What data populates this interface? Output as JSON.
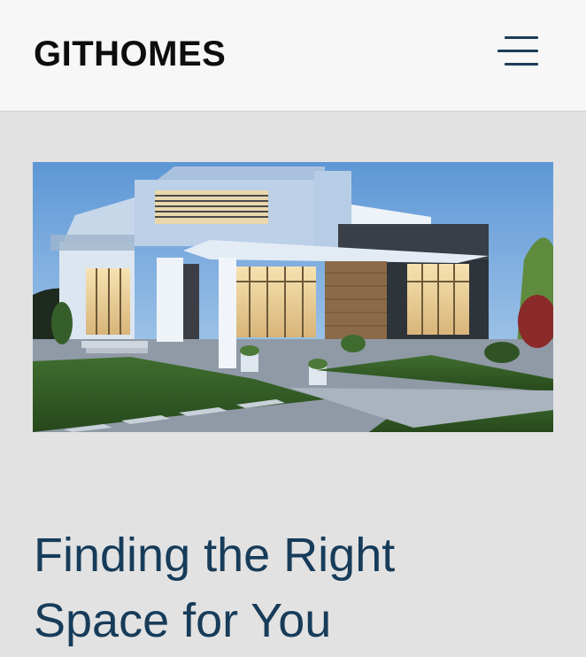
{
  "header": {
    "brand": "GITHOMES",
    "menu_icon": "hamburger-menu-icon"
  },
  "hero": {
    "image_subject": "modern two-story house at dusk"
  },
  "main": {
    "headline_line1": "Finding the Right",
    "headline_line2": "Space for You"
  },
  "colors": {
    "header_bg": "#f7f7f7",
    "page_bg": "#e2e2e2",
    "headline": "#173c5a",
    "menu_icon": "#1d3d57",
    "brand_text": "#0d0d0d"
  }
}
